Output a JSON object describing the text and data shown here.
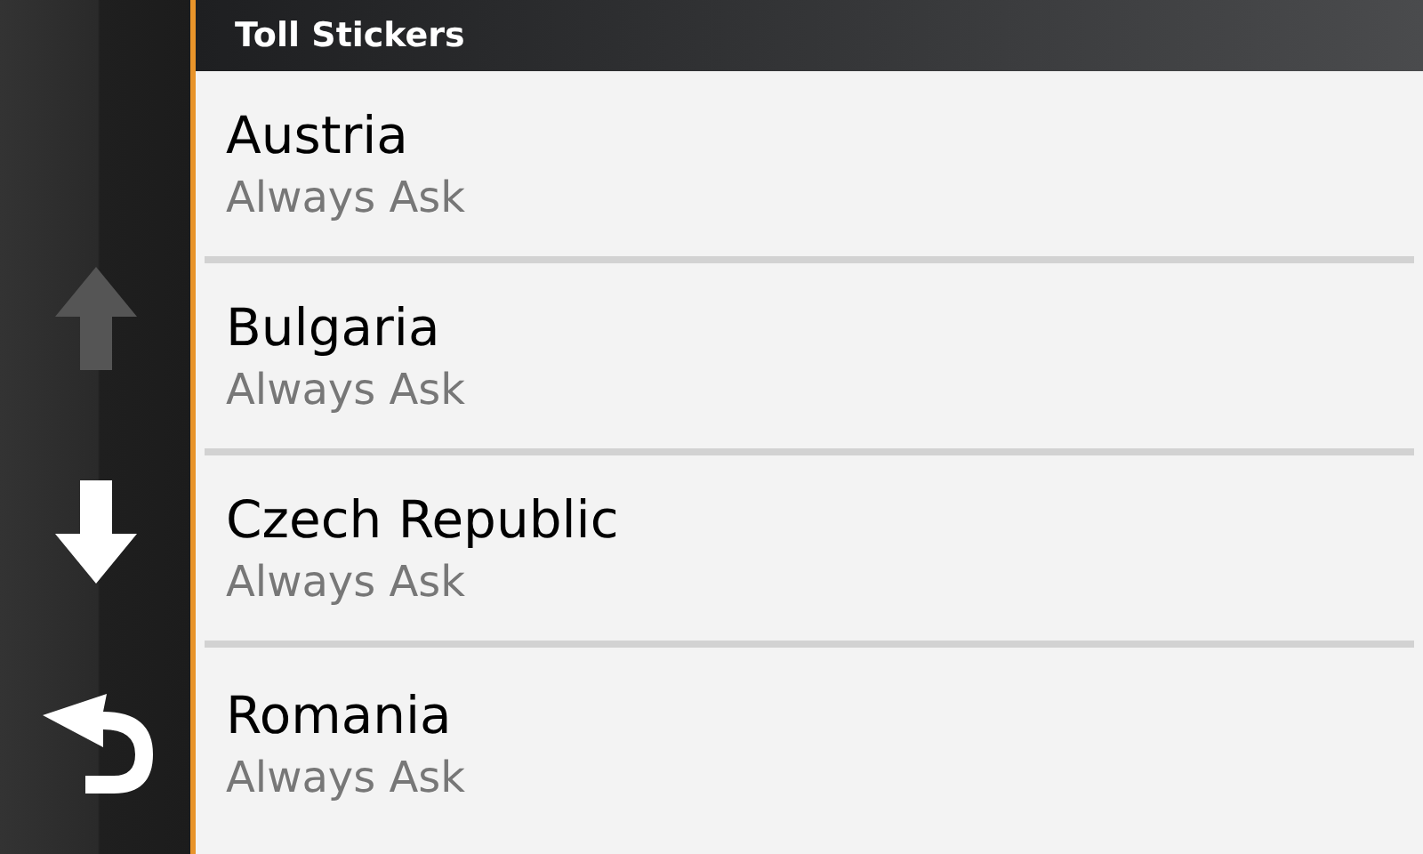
{
  "header": {
    "title": "Toll Stickers"
  },
  "nav": {
    "scroll_up": {
      "disabled": true
    },
    "scroll_down": {
      "disabled": false
    }
  },
  "items": [
    {
      "name": "Austria",
      "value": "Always Ask"
    },
    {
      "name": "Bulgaria",
      "value": "Always Ask"
    },
    {
      "name": "Czech Republic",
      "value": "Always Ask"
    },
    {
      "name": "Romania",
      "value": "Always Ask"
    }
  ]
}
